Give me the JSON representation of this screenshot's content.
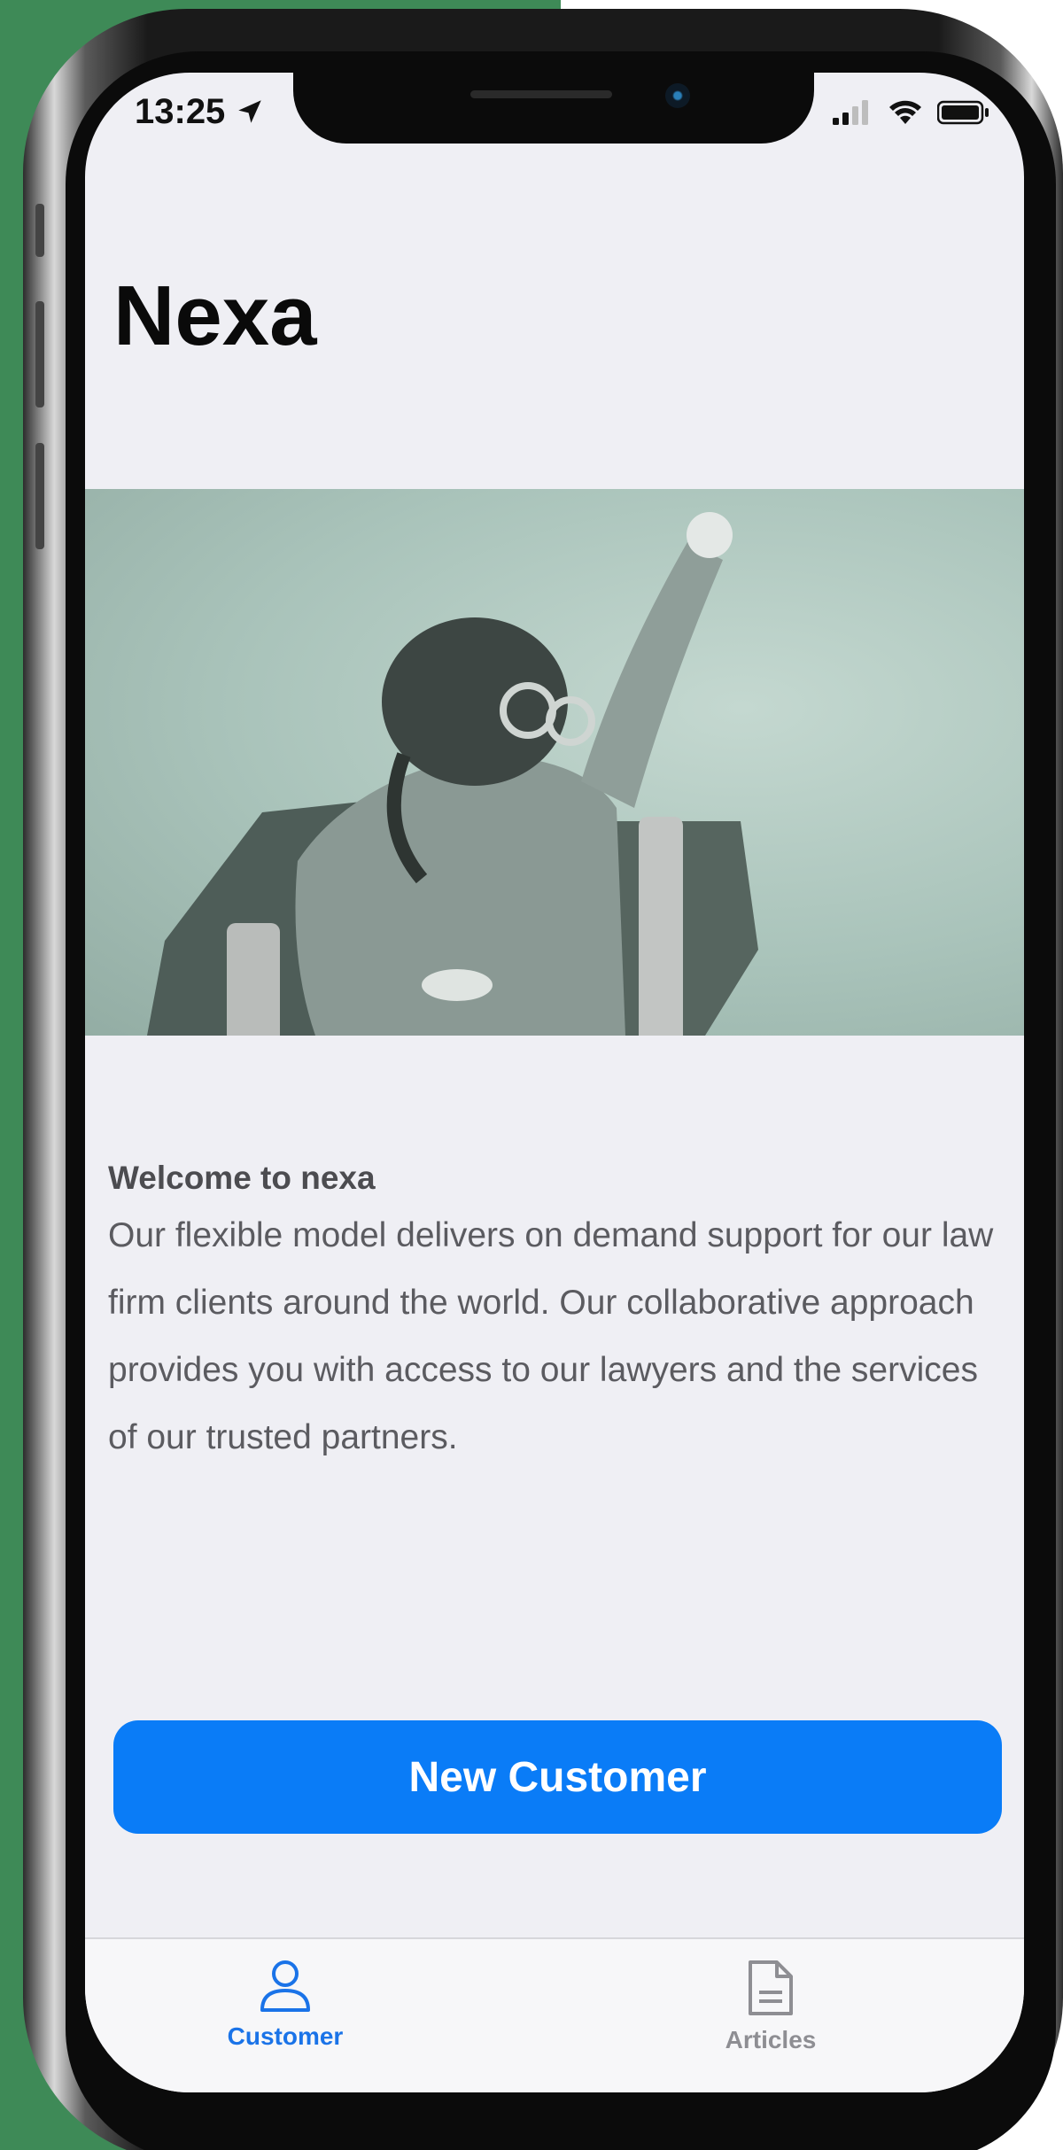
{
  "status_bar": {
    "time": "13:25",
    "location_icon": "location-arrow-icon",
    "signal_icon": "cellular-signal-icon",
    "wifi_icon": "wifi-icon",
    "battery_icon": "battery-icon"
  },
  "header": {
    "title": "Nexa"
  },
  "hero_image": {
    "subject": "hero-photo"
  },
  "content": {
    "heading": "Welcome to nexa",
    "body": "Our flexible model delivers on demand support for our law firm clients around the world.  Our collaborative approach provides you with access to our lawyers and the services of our trusted partners."
  },
  "actions": {
    "primary_label": "New Customer"
  },
  "tab_bar": {
    "tabs": [
      {
        "label": "Customer",
        "icon": "person-icon",
        "selected": true
      },
      {
        "label": "Articles",
        "icon": "document-icon",
        "selected": false
      }
    ]
  },
  "colors": {
    "accent": "#0a7cf7",
    "backdrop_green": "#3e8a57",
    "screen_bg": "#efeff4",
    "tab_active": "#1a73e8",
    "tab_inactive": "#8e8e93"
  }
}
